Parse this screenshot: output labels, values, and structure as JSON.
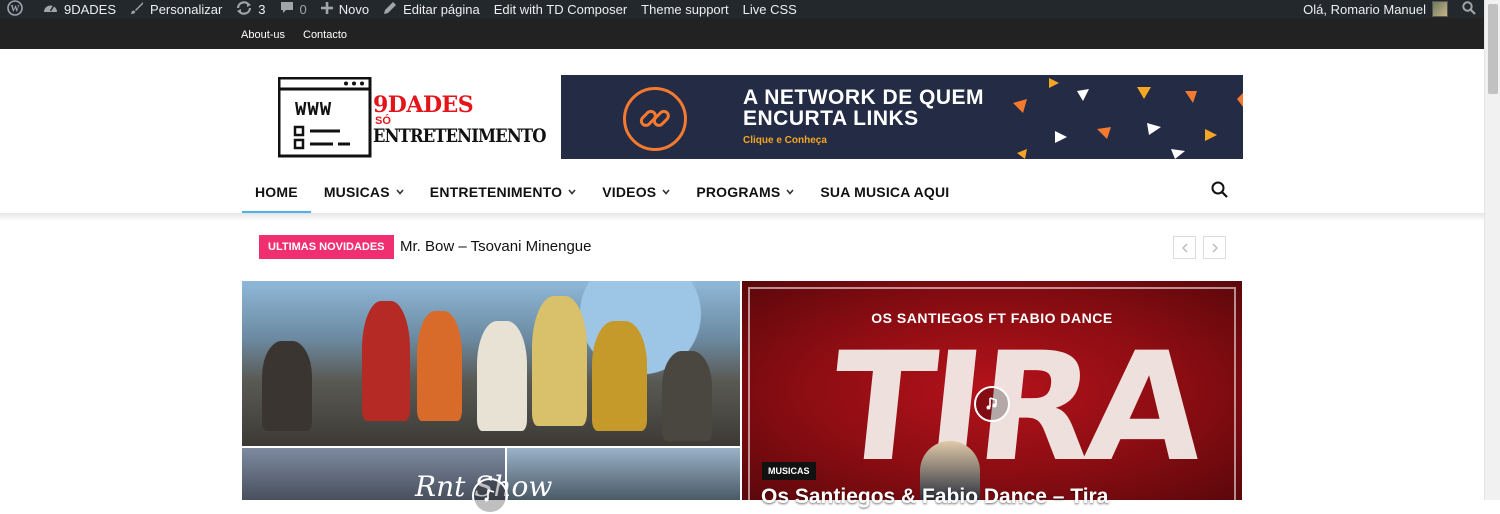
{
  "adminbar": {
    "site_name": "9DADES",
    "customize": "Personalizar",
    "updates_count": "3",
    "comments_count": "0",
    "new": "Novo",
    "edit_page": "Editar página",
    "td_composer": "Edit with TD Composer",
    "theme_support": "Theme support",
    "live_css": "Live CSS",
    "greeting": "Olá, Romario Manuel"
  },
  "top_menu": [
    "About-us",
    "Contacto"
  ],
  "logo": {
    "www": "WWW",
    "title": "9DADES",
    "so": "SÓ",
    "subtitle": "ENTRETENIMENTO",
    "title_color": "#e3151a"
  },
  "banner": {
    "line1": "A NETWORK DE QUEM",
    "line2": "ENCURTA LINKS",
    "cta": "Clique e Conheça",
    "bg_color": "#232b45",
    "accent_color": "#f47a30"
  },
  "nav": {
    "items": [
      {
        "label": "HOME",
        "dropdown": false,
        "active": true
      },
      {
        "label": "MUSICAS",
        "dropdown": true,
        "active": false
      },
      {
        "label": "ENTRETENIMENTO",
        "dropdown": true,
        "active": false
      },
      {
        "label": "VIDEOS",
        "dropdown": true,
        "active": false
      },
      {
        "label": "PROGRAMS",
        "dropdown": true,
        "active": false
      },
      {
        "label": "SUA MUSICA AQUI",
        "dropdown": false,
        "active": false
      }
    ],
    "active_color": "#4db2ec"
  },
  "ticker": {
    "badge": "ULTIMAS NOVIDADES",
    "text": "Mr. Bow – Tsovani Minengue",
    "badge_color": "#f02f71"
  },
  "featured": {
    "right": {
      "artwork_title": "OS SANTIEGOS FT FABIO DANCE",
      "artwork_big": "TIRA",
      "category": "MUSICAS",
      "title": "Os Santiegos & Fabio Dance – Tira"
    },
    "left_bottom_script": "Rnt Show"
  }
}
